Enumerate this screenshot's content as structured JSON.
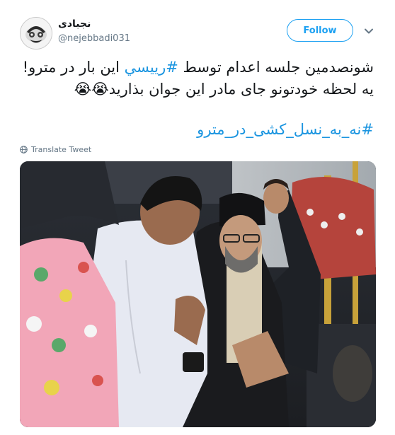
{
  "user": {
    "display_name": "نجبادی",
    "handle": "@nejebbadi031",
    "avatar_icon": "avatar-image"
  },
  "follow_button": {
    "label": "Follow"
  },
  "menu": {
    "icon": "chevron-down-icon"
  },
  "tweet": {
    "line1_before": "شونصدمین جلسه اعدام توسط ",
    "line1_hashtag": "#رییسي",
    "line1_after": " این بار در مترو!",
    "line2": "یه لحظه خودتونو جای مادر این جوان بذارید😭😭",
    "hashtag2": "#نه_به_نسل_کشی_در_مترو"
  },
  "translate": {
    "label": "Translate Tweet",
    "icon": "globe-icon"
  },
  "photo": {
    "alt_icon": "photo-metro-image"
  },
  "colors": {
    "accent": "#1da1f2",
    "link": "#1b95e0",
    "secondary": "#657786"
  }
}
